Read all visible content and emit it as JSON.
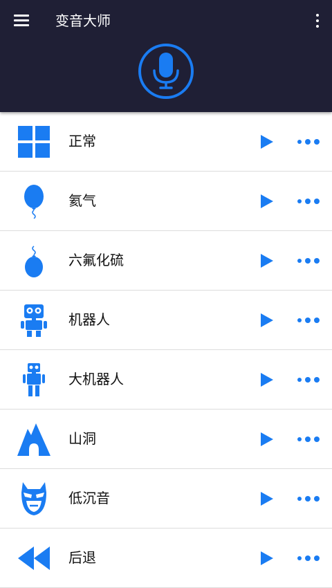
{
  "app": {
    "title": "变音大师",
    "accent_color": "#1a7cf2",
    "header_color": "#1f1f35"
  },
  "toolbar": {
    "menu_icon": "hamburger-menu-icon",
    "overflow_icon": "vertical-dots-icon",
    "record_icon": "microphone-icon"
  },
  "effects": [
    {
      "label": "正常",
      "icon": "grid-icon"
    },
    {
      "label": "氦气",
      "icon": "balloon-icon"
    },
    {
      "label": "六氟化硫",
      "icon": "heavy-balloon-icon"
    },
    {
      "label": "机器人",
      "icon": "robot-icon"
    },
    {
      "label": "大机器人",
      "icon": "tall-robot-icon"
    },
    {
      "label": "山洞",
      "icon": "cave-icon"
    },
    {
      "label": "低沉音",
      "icon": "mask-icon"
    },
    {
      "label": "后退",
      "icon": "rewind-icon"
    }
  ]
}
